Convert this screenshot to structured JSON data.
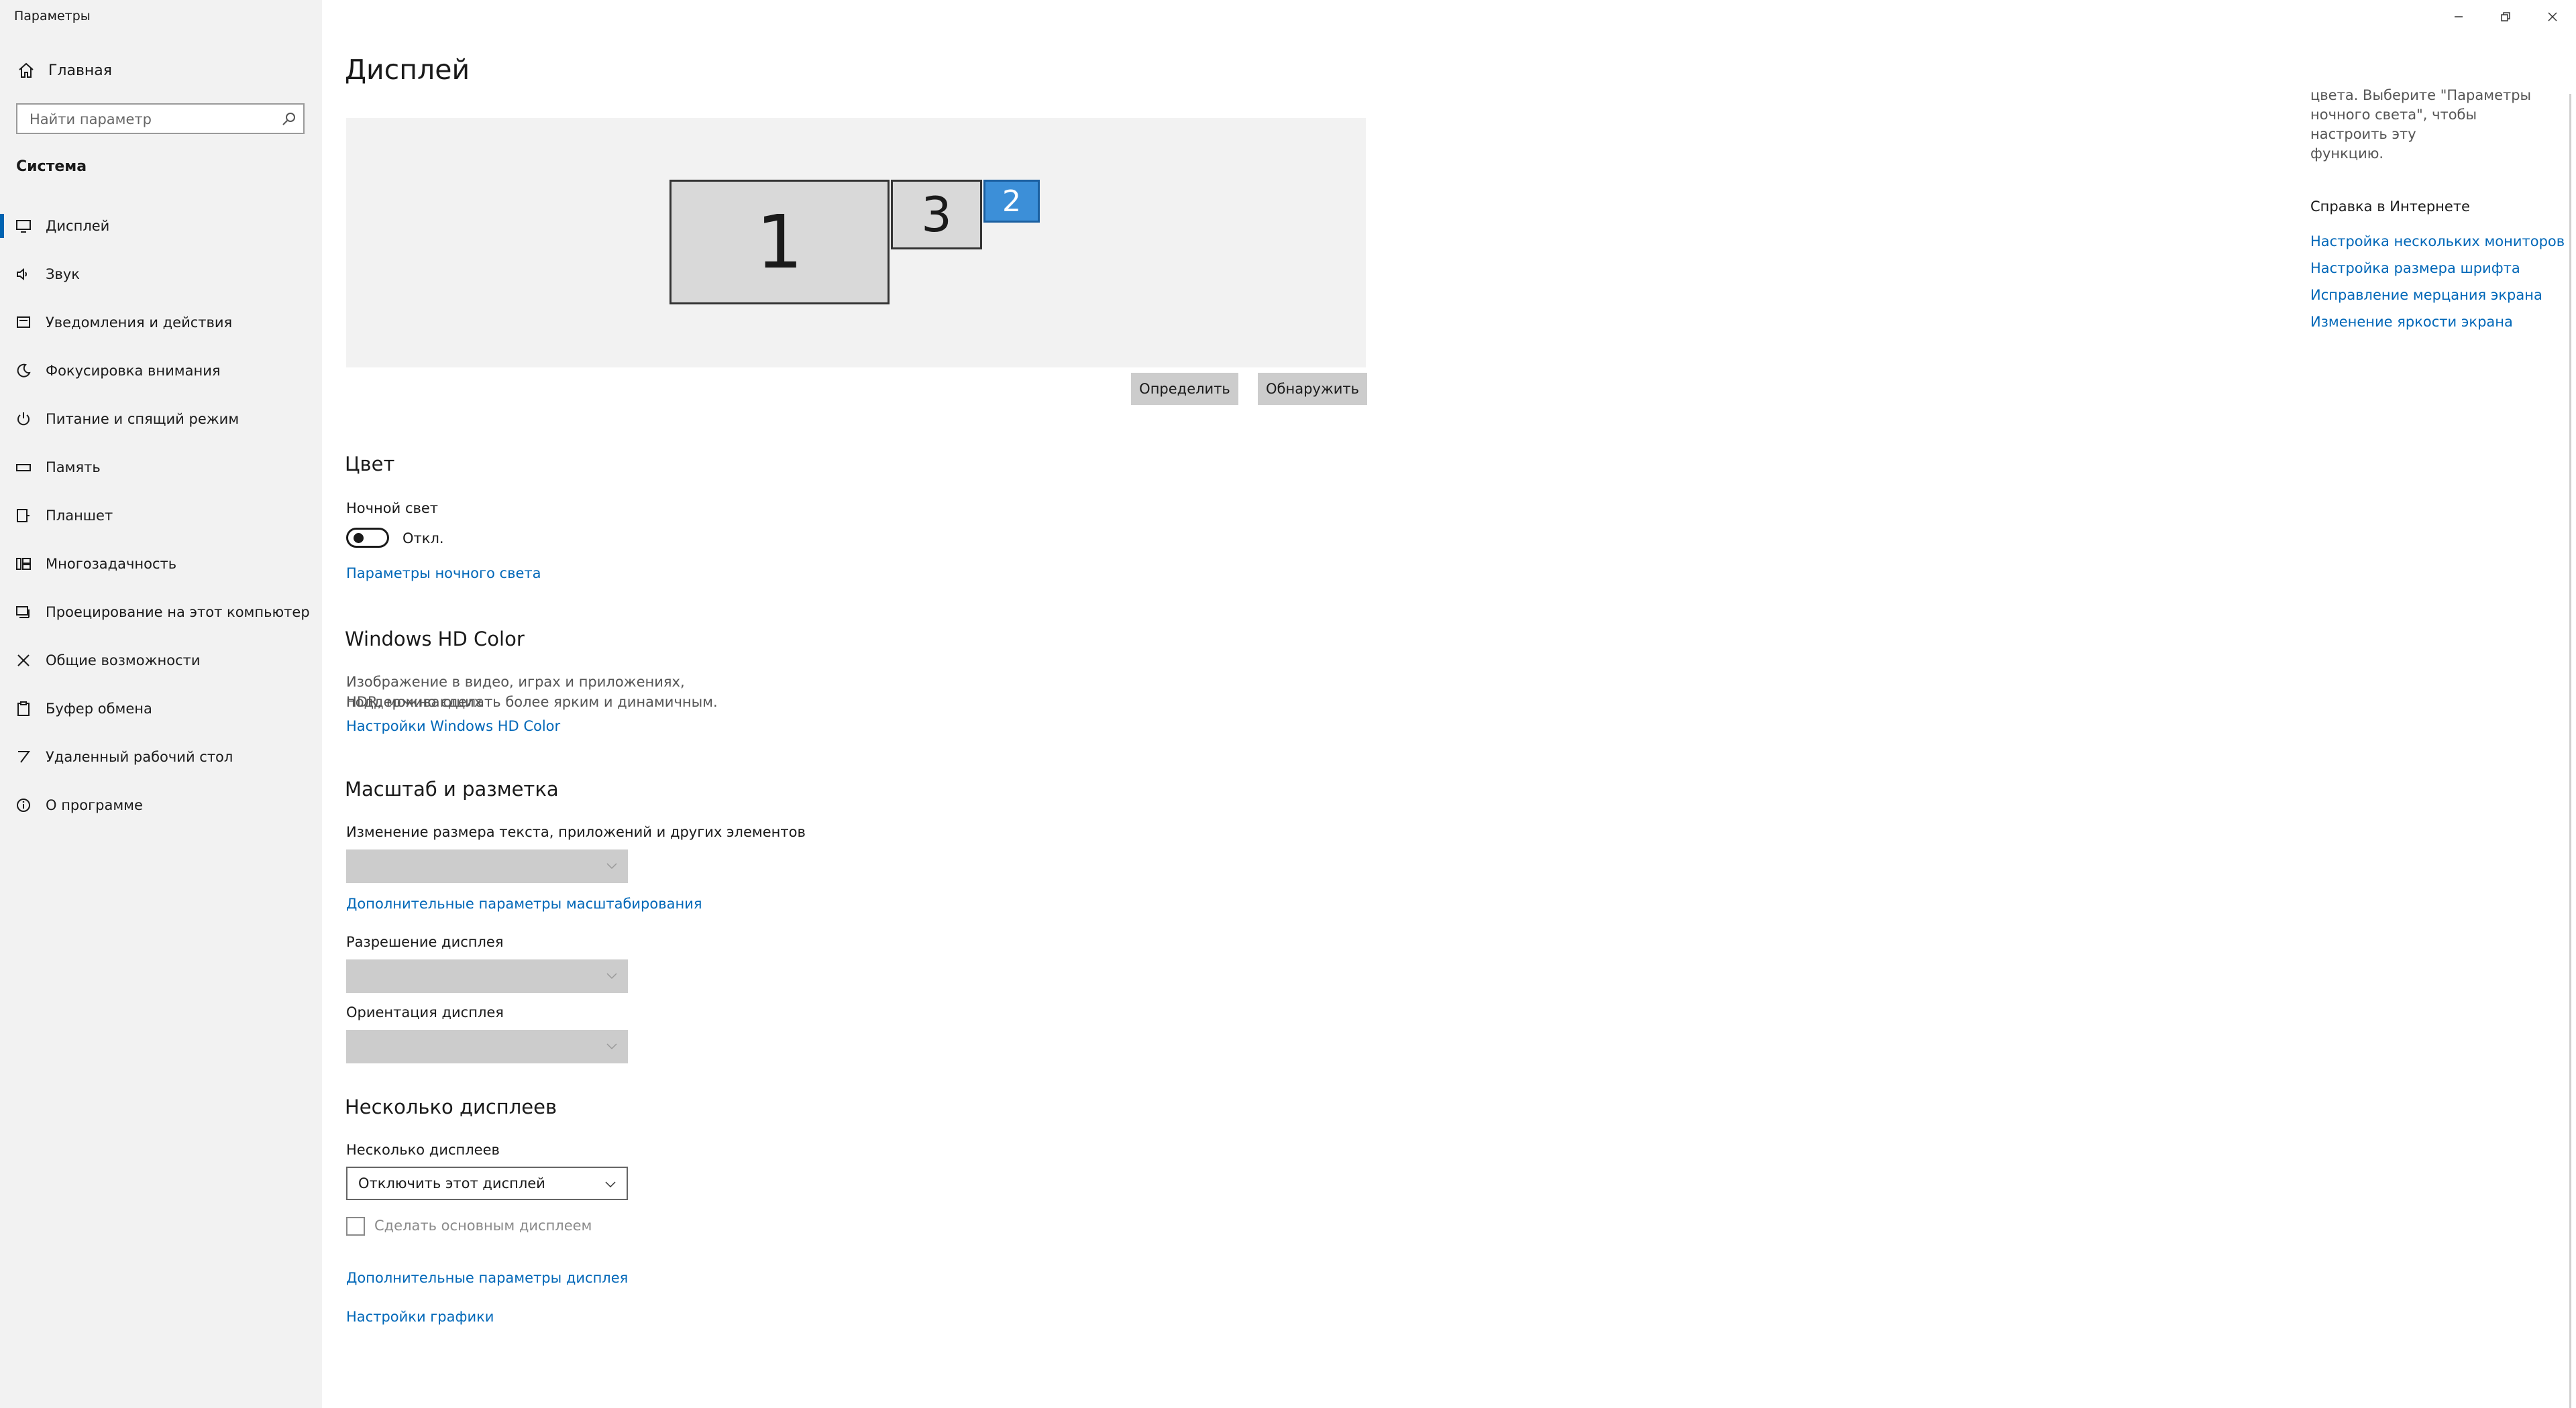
{
  "window": {
    "title": "Параметры"
  },
  "sidebar": {
    "home_label": "Главная",
    "search_placeholder": "Найти параметр",
    "section": "Система",
    "items": [
      {
        "label": "Дисплей",
        "icon": "monitor-icon",
        "active": true
      },
      {
        "label": "Звук",
        "icon": "speaker-icon"
      },
      {
        "label": "Уведомления и действия",
        "icon": "notification-icon"
      },
      {
        "label": "Фокусировка внимания",
        "icon": "moon-icon"
      },
      {
        "label": "Питание и спящий режим",
        "icon": "power-icon"
      },
      {
        "label": "Память",
        "icon": "storage-icon"
      },
      {
        "label": "Планшет",
        "icon": "tablet-icon"
      },
      {
        "label": "Многозадачность",
        "icon": "multitasking-icon"
      },
      {
        "label": "Проецирование на этот компьютер",
        "icon": "project-icon"
      },
      {
        "label": "Общие возможности",
        "icon": "shared-experiences-icon"
      },
      {
        "label": "Буфер обмена",
        "icon": "clipboard-icon"
      },
      {
        "label": "Удаленный рабочий стол",
        "icon": "remote-desktop-icon"
      },
      {
        "label": "О программе",
        "icon": "info-icon"
      }
    ]
  },
  "main": {
    "title": "Дисплей",
    "monitors": [
      "1",
      "3",
      "2"
    ],
    "identify_button": "Определить",
    "detect_button": "Обнаружить",
    "color": {
      "heading": "Цвет",
      "night_light_label": "Ночной свет",
      "night_light_state": "Откл.",
      "night_light_settings_link": "Параметры ночного света"
    },
    "hdr": {
      "heading": "Windows HD Color",
      "description_line1": "Изображение в видео, играх и приложениях, поддерживающих",
      "description_line2": "HDR, можно сделать более ярким и динамичным.",
      "settings_link": "Настройки Windows HD Color"
    },
    "scale": {
      "heading": "Масштаб и разметка",
      "size_label": "Изменение размера текста, приложений и других элементов",
      "advanced_scaling_link": "Дополнительные параметры масштабирования",
      "resolution_label": "Разрешение дисплея",
      "orientation_label": "Ориентация дисплея"
    },
    "multi": {
      "heading": "Несколько дисплеев",
      "label": "Несколько дисплеев",
      "selected": "Отключить этот дисплей",
      "make_main_label": "Сделать основным дисплеем",
      "advanced_display_link": "Дополнительные параметры дисплея",
      "graphics_link": "Настройки графики"
    }
  },
  "right_pane": {
    "text_line1": "цвета. Выберите \"Параметры",
    "text_line2": "ночного света\", чтобы настроить эту",
    "text_line3": "функцию.",
    "help_title": "Справка в Интернете",
    "links": [
      "Настройка нескольких мониторов",
      "Настройка размера шрифта",
      "Исправление мерцания экрана",
      "Изменение яркости экрана"
    ]
  }
}
